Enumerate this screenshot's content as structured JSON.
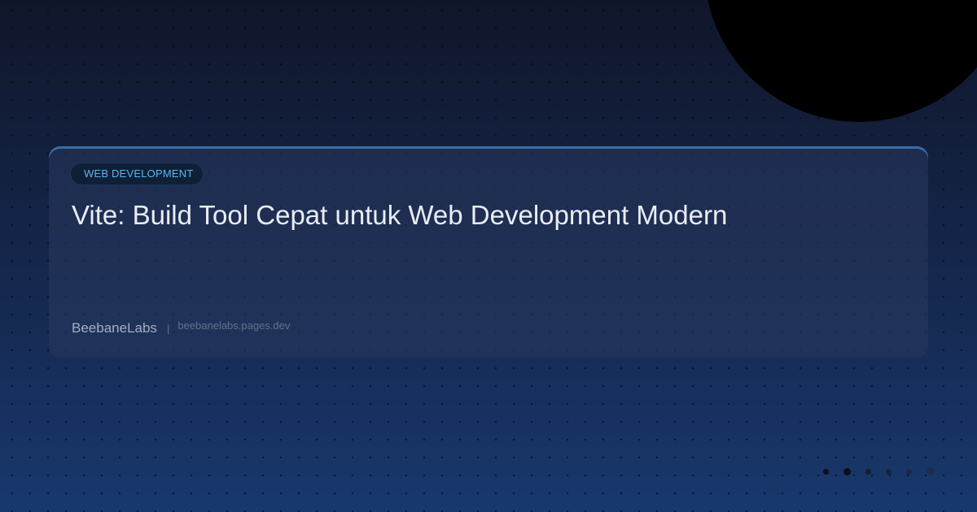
{
  "card": {
    "category": "WEB DEVELOPMENT",
    "title": "Vite: Build Tool Cepat untuk Web Development Modern",
    "brand": "BeebaneLabs",
    "separator": "|",
    "domain": "beebanelabs.pages.dev"
  },
  "colors": {
    "accent": "#5ab4ec",
    "card_border": "#3a6ea8",
    "background_top": "#10162a",
    "background_bottom": "#18386d"
  }
}
